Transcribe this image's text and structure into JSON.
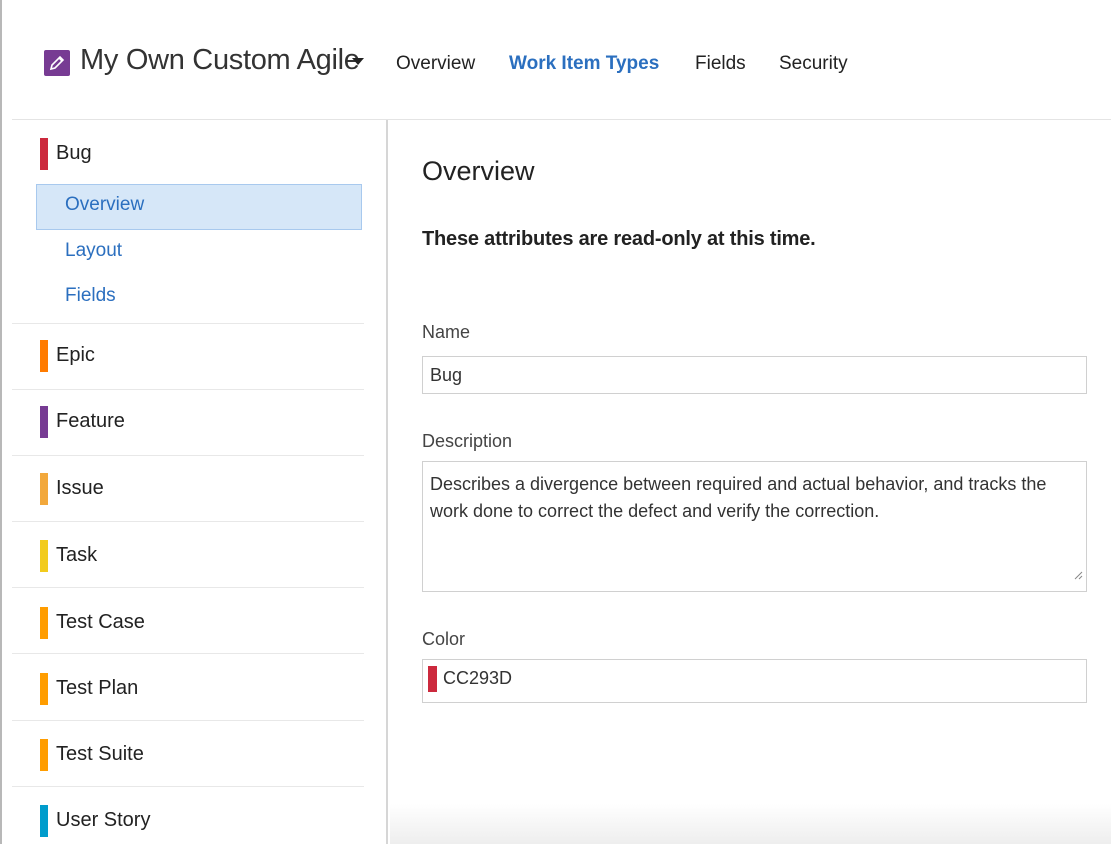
{
  "header": {
    "process_name": "My Own Custom Agile",
    "tabs": [
      {
        "label": "Overview",
        "active": false
      },
      {
        "label": "Work Item Types",
        "active": true
      },
      {
        "label": "Fields",
        "active": false
      },
      {
        "label": "Security",
        "active": false
      }
    ]
  },
  "sidebar": {
    "work_item_types": [
      {
        "label": "Bug",
        "color": "#cc293d",
        "expanded": true,
        "children": [
          {
            "label": "Overview",
            "selected": true
          },
          {
            "label": "Layout",
            "selected": false
          },
          {
            "label": "Fields",
            "selected": false
          }
        ]
      },
      {
        "label": "Epic",
        "color": "#ff7b00"
      },
      {
        "label": "Feature",
        "color": "#773b93"
      },
      {
        "label": "Issue",
        "color": "#f2a83c"
      },
      {
        "label": "Task",
        "color": "#f2cb1d"
      },
      {
        "label": "Test Case",
        "color": "#ff9d00"
      },
      {
        "label": "Test Plan",
        "color": "#ff9d00"
      },
      {
        "label": "Test Suite",
        "color": "#ff9d00"
      },
      {
        "label": "User Story",
        "color": "#009ccc"
      }
    ]
  },
  "main": {
    "heading": "Overview",
    "notice": "These attributes are read-only at this time.",
    "name_label": "Name",
    "name_value": "Bug",
    "description_label": "Description",
    "description_value": "Describes a divergence between required and actual behavior, and tracks the work done to correct the defect and verify the correction.",
    "color_label": "Color",
    "color_value": "CC293D",
    "color_swatch": "#cc293d"
  },
  "icons": {
    "process": "pencil-icon",
    "dropdown": "caret-down-icon",
    "textarea_resize": "resize-grip-icon"
  },
  "colors": {
    "accent": "#2b6fbf",
    "selected_bg": "#d6e7f8"
  }
}
